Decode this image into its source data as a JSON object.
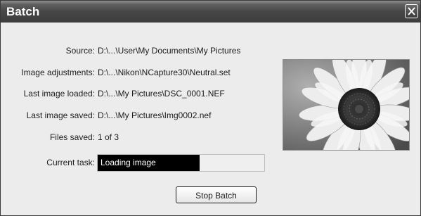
{
  "window": {
    "title": "Batch"
  },
  "fields": [
    {
      "label": "Source:",
      "value": "D:\\...\\User\\My Documents\\My Pictures"
    },
    {
      "label": "Image adjustments:",
      "value": "D:\\...\\Nikon\\NCapture30\\Neutral.set"
    },
    {
      "label": "Last image loaded:",
      "value": "D:\\...\\My Pictures\\DSC_0001.NEF"
    },
    {
      "label": "Last image saved:",
      "value": "D:\\...\\My Pictures\\Img0002.nef"
    },
    {
      "label": "Files saved:",
      "value": "1 of 3"
    }
  ],
  "task": {
    "label": "Current task:",
    "status": "Loading image",
    "progress_fraction": 0.61
  },
  "buttons": {
    "stop_label": "Stop Batch"
  },
  "icons": {
    "close": "close-icon",
    "preview": "sunflower-preview-image"
  },
  "colors": {
    "titlebar": "#474747",
    "progress_fill": "#000000",
    "background": "#ececec"
  }
}
